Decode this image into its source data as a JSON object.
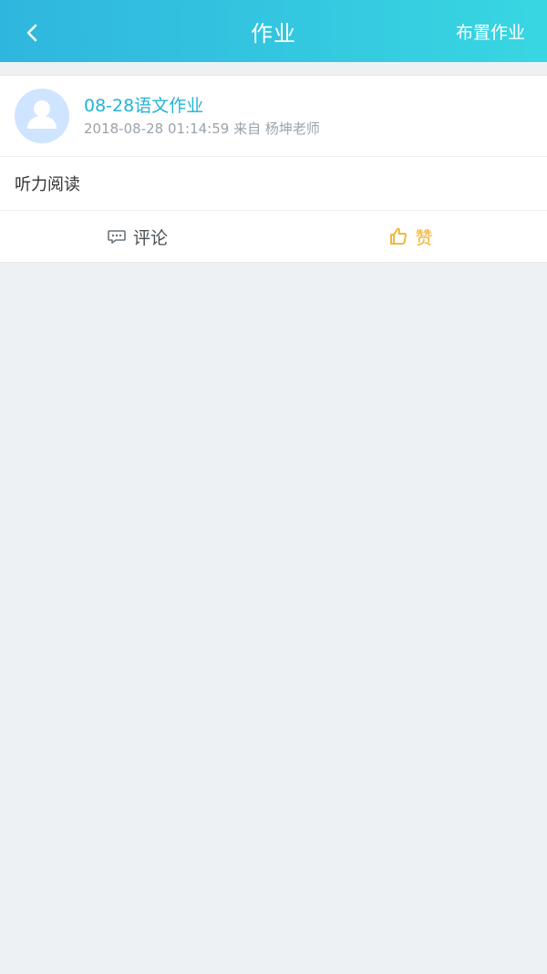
{
  "header": {
    "title": "作业",
    "right_action": "布置作业",
    "icons": {
      "back": "chevron-left-icon"
    }
  },
  "post": {
    "title": "08-28语文作业",
    "subtitle": "2018-08-28 01:14:59 来自 杨坤老师",
    "content": "听力阅读",
    "icons": {
      "avatar": "user-avatar-icon"
    }
  },
  "actions": {
    "comment_label": "评论",
    "like_label": "赞",
    "icons": {
      "comment": "comment-icon",
      "like": "thumbs-up-icon"
    }
  },
  "colors": {
    "header_start": "#2FB6DE",
    "header_end": "#38D6E2",
    "title_accent": "#22B4D8",
    "like_accent": "#F0B12B",
    "background": "#EEF1F4"
  }
}
